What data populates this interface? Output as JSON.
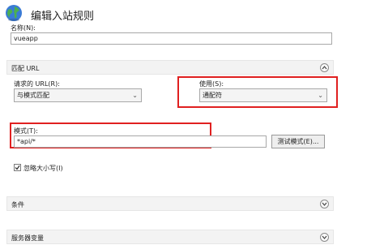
{
  "header": {
    "title": "编辑入站规则",
    "icon": "globe-icon"
  },
  "name_field": {
    "label": "名称(N):",
    "value": "vueapp"
  },
  "match_url": {
    "header": "匹配 URL",
    "requested_url_label": "请求的 URL(R):",
    "requested_url_value": "与模式匹配",
    "using_label": "使用(S):",
    "using_value": "通配符",
    "pattern_label": "模式(T):",
    "pattern_value": "*api/*",
    "test_button": "测试模式(E)...",
    "ignore_case_label": "忽略大小写(I)",
    "ignore_case_checked": true
  },
  "conditions": {
    "header": "条件"
  },
  "server_variables": {
    "header": "服务器变量"
  },
  "colors": {
    "highlight": "#e02020",
    "section_bg": "#f3f3f3"
  }
}
